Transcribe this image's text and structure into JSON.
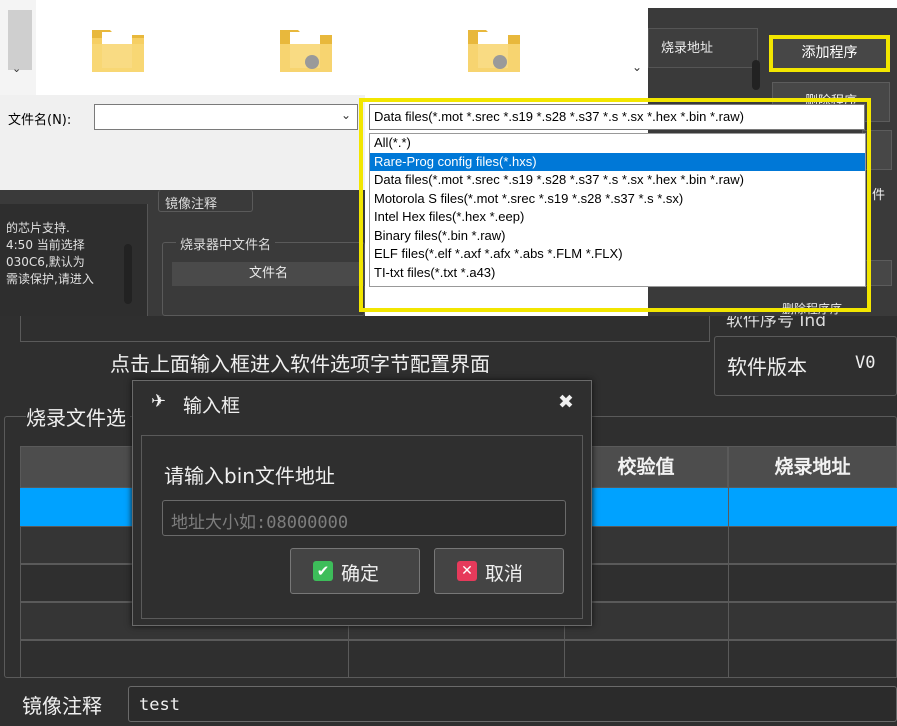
{
  "file_dialog": {
    "filename_label": "文件名(N):",
    "filename_value": "",
    "filter_selected": "Data files(*.mot *.srec *.s19 *.s28 *.s37 *.s *.sx *.hex *.bin *.raw)",
    "filter_options": [
      "All(*.*)",
      "Rare-Prog config files(*.hxs)",
      "Data files(*.mot *.srec *.s19 *.s28 *.s37 *.s *.sx *.hex *.bin *.raw)",
      "Motorola S files(*.mot *.srec *.s19 *.s28 *.s37 *.s *.sx)",
      "Intel Hex files(*.hex *.eep)",
      "Binary files(*.bin *.raw)",
      "ELF files(*.elf *.axf *.afx *.abs *.FLM *.FLX)",
      "TI-txt files(*.txt *.a43)"
    ],
    "highlight_color": "#0078d7",
    "callout_color": "#f2e600"
  },
  "app_top": {
    "burn_address_header": "烧录地址",
    "add_program": "添加程序",
    "delete_program": "删除程序",
    "mirror_note_label": "镜像注释",
    "programmer_filename_group": "烧录器中文件名",
    "filename_column": "文件名",
    "side_char": "件",
    "bottom_right_btn": "删除程序序",
    "log_lines": [
      "的芯片支持.",
      "4:50 当前选择",
      "030C6,默认为",
      "需读保护,请进入"
    ]
  },
  "app_bottom": {
    "software_option_hint": "点击上面输入框进入软件选项字节配置界面",
    "software_version_label": "软件版本",
    "software_version_value": "V0",
    "cropped_top_text": "软件序号 Ind",
    "burn_files_group": "烧录文件选",
    "columns": [
      "",
      "校验值",
      "烧录地址"
    ],
    "mirror_note_label": "镜像注释",
    "mirror_note_value": "test",
    "selected_row_color": "#00a2ff"
  },
  "input_dialog": {
    "title": "输入框",
    "prompt": "请输入bin文件地址",
    "placeholder": "地址大小如:08000000",
    "ok_label": "确定",
    "cancel_label": "取消",
    "icon": "plane-icon",
    "close_icon": "close-icon"
  }
}
